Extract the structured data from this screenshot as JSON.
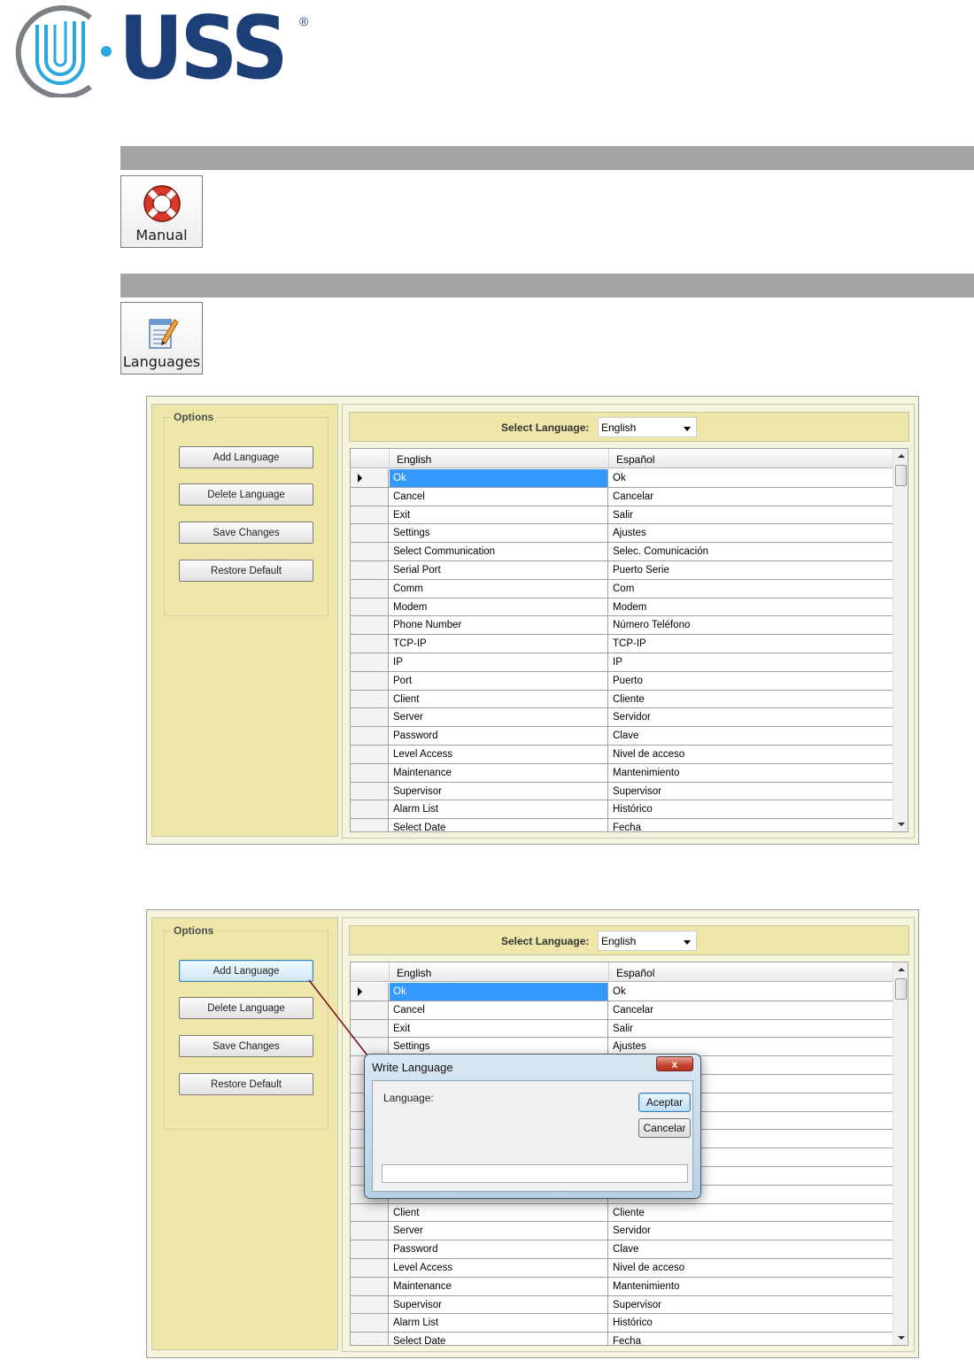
{
  "brand": {
    "logo_text": "USS",
    "registered_mark": "®"
  },
  "manual_tile": {
    "label": "Manual",
    "icon": "lifebuoy-icon"
  },
  "languages_tile": {
    "label": "Languages",
    "icon": "notepad-pencil-icon"
  },
  "window1": {
    "options": {
      "title": "Options",
      "buttons": [
        "Add Language",
        "Delete Language",
        "Save Changes",
        "Restore Default"
      ]
    },
    "select_language": {
      "label": "Select Language:",
      "value": "English"
    },
    "table": {
      "columns": [
        "English",
        "Español"
      ],
      "rows": [
        [
          "Ok",
          "Ok"
        ],
        [
          "Cancel",
          "Cancelar"
        ],
        [
          "Exit",
          "Salir"
        ],
        [
          "Settings",
          "Ajustes"
        ],
        [
          "Select Communication",
          "Selec. Comunicación"
        ],
        [
          "Serial Port",
          "Puerto Serie"
        ],
        [
          "Comm",
          "Com"
        ],
        [
          "Modem",
          "Modem"
        ],
        [
          "Phone Number",
          "Número Teléfono"
        ],
        [
          "TCP-IP",
          "TCP-IP"
        ],
        [
          "IP",
          "IP"
        ],
        [
          "Port",
          "Puerto"
        ],
        [
          "Client",
          "Cliente"
        ],
        [
          "Server",
          "Servidor"
        ],
        [
          "Password",
          "Clave"
        ],
        [
          "Level Access",
          "Nivel de acceso"
        ],
        [
          "Maintenance",
          "Mantenimiento"
        ],
        [
          "Supervisor",
          "Supervisor"
        ],
        [
          "Alarm List",
          "Histórico"
        ],
        [
          "Select Date",
          "Fecha"
        ]
      ]
    }
  },
  "window2": {
    "options": {
      "title": "Options",
      "buttons": [
        "Add Language",
        "Delete Language",
        "Save Changes",
        "Restore Default"
      ]
    },
    "select_language": {
      "label": "Select Language:",
      "value": "English"
    },
    "table": {
      "columns": [
        "English",
        "Español"
      ],
      "rows": [
        [
          "Ok",
          "Ok"
        ],
        [
          "Cancel",
          "Cancelar"
        ],
        [
          "Exit",
          "Salir"
        ],
        [
          "Settings",
          "Ajustes"
        ],
        [
          "",
          ""
        ],
        [
          "",
          ""
        ],
        [
          "",
          ""
        ],
        [
          "",
          ""
        ],
        [
          "",
          ""
        ],
        [
          "",
          ""
        ],
        [
          "",
          ""
        ],
        [
          "",
          ""
        ],
        [
          "Client",
          "Cliente"
        ],
        [
          "Server",
          "Servidor"
        ],
        [
          "Password",
          "Clave"
        ],
        [
          "Level Access",
          "Nivel de acceso"
        ],
        [
          "Maintenance",
          "Mantenimiento"
        ],
        [
          "Supervisor",
          "Supervisor"
        ],
        [
          "Alarm List",
          "Histórico"
        ],
        [
          "Select Date",
          "Fecha"
        ]
      ]
    },
    "dialog": {
      "title": "Write Language",
      "close": "x",
      "label": "Language:",
      "accept": "Aceptar",
      "cancel": "Cancelar",
      "input_value": ""
    }
  },
  "colors": {
    "accent": "#1d3f78",
    "selection": "#3399ff",
    "panel": "#efe6a9"
  }
}
